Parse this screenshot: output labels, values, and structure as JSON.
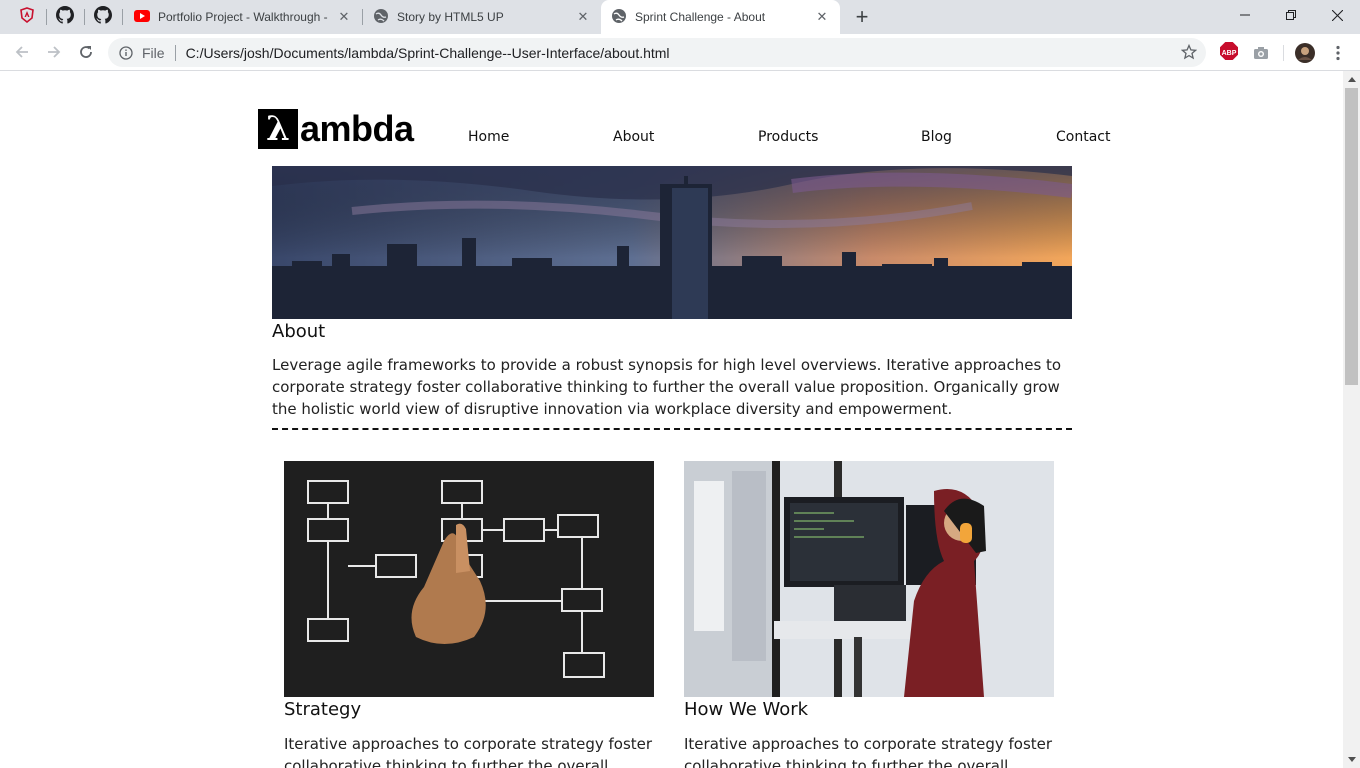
{
  "browser": {
    "tabs": [
      {
        "title": "Portfolio Project - Walkthrough -",
        "icon": "youtube-icon"
      },
      {
        "title": "Story by HTML5 UP",
        "icon": "globe-icon"
      },
      {
        "title": "Sprint Challenge - About",
        "icon": "globe-icon",
        "active": true
      }
    ],
    "pinned_icons": [
      "shield-icon",
      "github-icon",
      "github-icon"
    ],
    "address": {
      "scheme_label": "File",
      "url": "C:/Users/josh/Documents/lambda/Sprint-Challenge--User-Interface/about.html"
    },
    "extensions": [
      "abp-icon",
      "camera-icon",
      "profile-avatar"
    ],
    "abp_label": "ABP"
  },
  "page": {
    "logo": {
      "mark": "λ",
      "text": "ambda"
    },
    "nav": [
      "Home",
      "About",
      "Products",
      "Blog",
      "Contact"
    ],
    "about": {
      "title": "About",
      "text": "Leverage agile frameworks to provide a robust synopsis for high level overviews. Iterative approaches to corporate strategy foster collaborative thinking to further the overall value proposition. Organically grow the holistic world view of disruptive innovation via workplace diversity and empowerment."
    },
    "cards": [
      {
        "title": "Strategy",
        "text": "Iterative approaches to corporate strategy foster collaborative thinking to further the overall value proposition."
      },
      {
        "title": "How We Work",
        "text": "Iterative approaches to corporate strategy foster collaborative thinking to further the overall value proposition."
      }
    ]
  },
  "colors": {
    "tabbar": "#dee1e6",
    "youtube": "#ff0000",
    "abp": "#c70d2c",
    "sky_top": "#3b4a6b",
    "sunset": "#f2a65a"
  }
}
